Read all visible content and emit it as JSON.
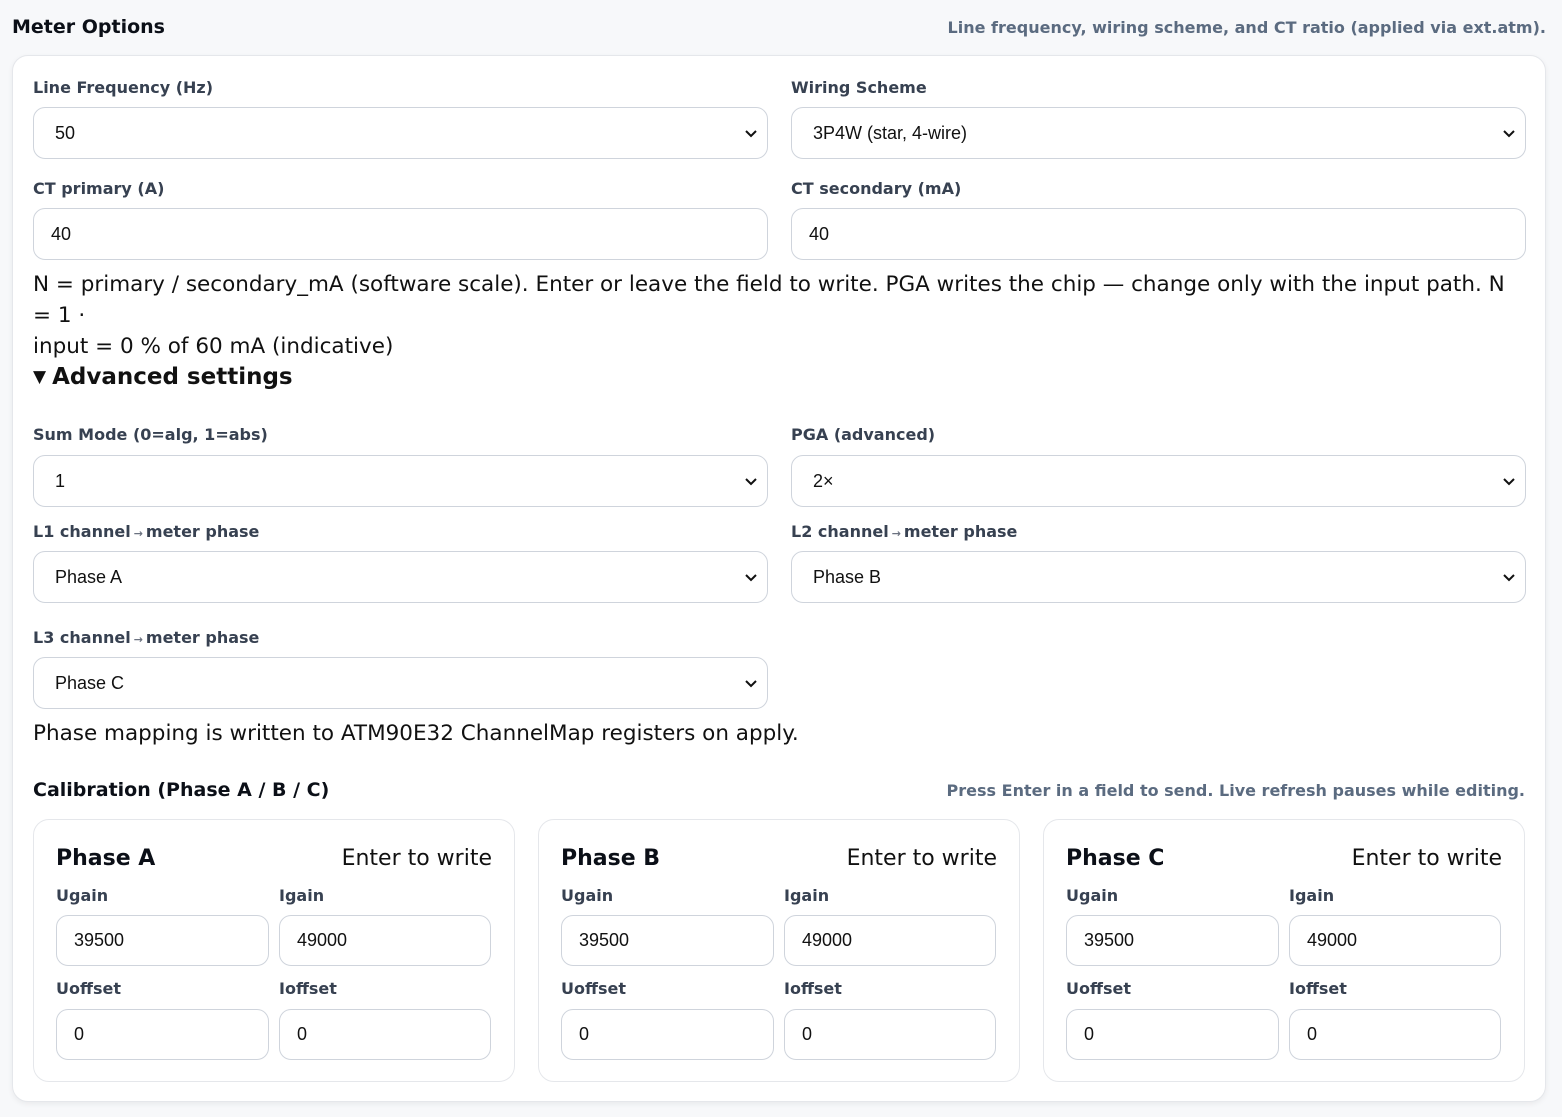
{
  "header": {
    "title": "Meter Options",
    "hint": "Line frequency, wiring scheme, and CT ratio (applied via ext.atm)."
  },
  "basic": {
    "line_frequency": {
      "label": "Line Frequency (Hz)",
      "value": "50"
    },
    "wiring_scheme": {
      "label": "Wiring Scheme",
      "value": "3P4W (star, 4-wire)"
    },
    "ct_primary": {
      "label": "CT primary (A)",
      "value": "40"
    },
    "ct_secondary": {
      "label": "CT secondary (mA)",
      "value": "40"
    },
    "help_line1": "N = primary / secondary_mA (software scale). Enter or leave the field to write. PGA writes the chip — change only with the input path. N = 1 ·",
    "help_line2": "input = 0 % of 60 mA (indicative)"
  },
  "advanced": {
    "toggle_label": "Advanced settings",
    "sum_mode": {
      "label": "Sum Mode (0=alg, 1=abs)",
      "value": "1"
    },
    "pga": {
      "label": "PGA (advanced)",
      "value": "2×"
    },
    "arrow": "→",
    "l1": {
      "label_a": "L1 channel",
      "label_b": "meter phase",
      "value": "Phase A"
    },
    "l2": {
      "label_a": "L2 channel",
      "label_b": "meter phase",
      "value": "Phase B"
    },
    "l3": {
      "label_a": "L3 channel",
      "label_b": "meter phase",
      "value": "Phase C"
    },
    "mapping_note": "Phase mapping is written to ATM90E32 ChannelMap registers on apply."
  },
  "calibration": {
    "title": "Calibration (Phase A / B / C)",
    "hint": "Press Enter in a field to send. Live refresh pauses while editing.",
    "phases": [
      {
        "title": "Phase A",
        "note": "Enter to write",
        "ugain_label": "Ugain",
        "igain_label": "Igain",
        "uoffset_label": "Uoffset",
        "ioffset_label": "Ioffset",
        "ugain": "39500",
        "igain": "49000",
        "uoffset": "0",
        "ioffset": "0"
      },
      {
        "title": "Phase B",
        "note": "Enter to write",
        "ugain_label": "Ugain",
        "igain_label": "Igain",
        "uoffset_label": "Uoffset",
        "ioffset_label": "Ioffset",
        "ugain": "39500",
        "igain": "49000",
        "uoffset": "0",
        "ioffset": "0"
      },
      {
        "title": "Phase C",
        "note": "Enter to write",
        "ugain_label": "Ugain",
        "igain_label": "Igain",
        "uoffset_label": "Uoffset",
        "ioffset_label": "Ioffset",
        "ugain": "39500",
        "igain": "49000",
        "uoffset": "0",
        "ioffset": "0"
      }
    ]
  },
  "icons": {
    "select_chevron": "chevron-down-icon",
    "disclosure": "triangle-down-icon"
  }
}
